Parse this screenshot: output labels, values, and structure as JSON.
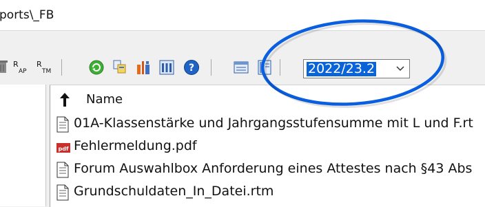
{
  "path": {
    "text": "ports\\_FB"
  },
  "toolbar": {
    "label_ap": "R",
    "label_ap_sub": "AP",
    "label_tm": "R",
    "label_tm_sub": "TM"
  },
  "combo": {
    "value": "2022/23.2"
  },
  "list": {
    "header": "Name",
    "files": [
      {
        "name": "01A-Klassenstärke und Jahrgangsstufensumme mit L und F.rt",
        "icon": "document-icon"
      },
      {
        "name": "Fehlermeldung.pdf",
        "icon": "pdf-icon"
      },
      {
        "name": "Forum Auswahlbox Anforderung eines Attestes nach §43 Abs",
        "icon": "document-icon"
      },
      {
        "name": "Grundschuldaten_In_Datei.rtm",
        "icon": "document-icon"
      }
    ]
  },
  "colors": {
    "highlight": "#0a5fe0",
    "selection": "#0a64d8"
  }
}
